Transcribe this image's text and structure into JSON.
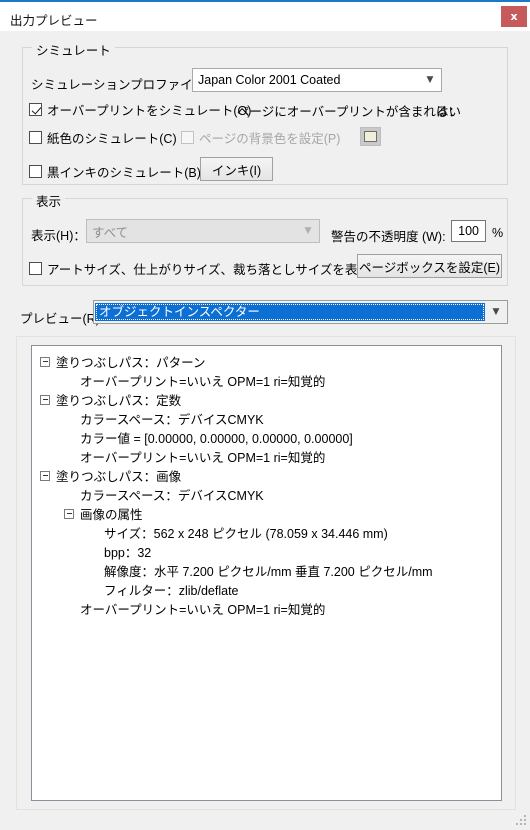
{
  "window": {
    "title": "出力プレビュー",
    "close_label": "x",
    "accent_color": "#1a7bc4",
    "close_color": "#c75b5b"
  },
  "simulate_group": {
    "title": "シミュレート",
    "profile_label": "シミュレーションプロファイル(S)：",
    "profile_value": "Japan Color 2001 Coated",
    "overprint_checkbox": "オーバープリントをシミュレート(O)",
    "overprint_checked": true,
    "overprint_info_label": "ページにオーバープリントが含まれる：",
    "overprint_info_value": "はい",
    "paper_color_checkbox": "紙色のシミュレート(C)",
    "paper_color_checked": false,
    "page_bg_checkbox": "ページの背景色を設定(P)",
    "page_bg_checked": false,
    "page_bg_disabled": true,
    "page_bg_swatch_color": "#f0f0da",
    "black_ink_checkbox": "黒インキのシミュレート(B)",
    "black_ink_checked": false,
    "ink_button": "インキ(I)"
  },
  "display_group": {
    "title": "表示",
    "show_label": "表示(H)：",
    "show_value": "すべて",
    "show_disabled": true,
    "warning_opacity_label": "警告の不透明度 (W):",
    "warning_opacity_value": "100",
    "percent_sign": "%",
    "sizes_checkbox": "アートサイズ、仕上がりサイズ、裁ち落としサイズを表示(X)",
    "sizes_checked": false,
    "page_box_button": "ページボックスを設定(E)"
  },
  "preview": {
    "label": "プレビュー(R)：",
    "value": "オブジェクトインスペクター",
    "highlight_color": "#0b6fd4"
  },
  "tree": [
    {
      "indent": 0,
      "toggle": true,
      "text": "塗りつぶしパス：パターン"
    },
    {
      "indent": 1,
      "toggle": false,
      "text": "オーバープリント=いいえ OPM=1 ri=知覚的"
    },
    {
      "indent": 0,
      "toggle": true,
      "text": "塗りつぶしパス：定数"
    },
    {
      "indent": 1,
      "toggle": false,
      "text": "カラースペース：デバイスCMYK"
    },
    {
      "indent": 1,
      "toggle": false,
      "text": "カラー値 = [0.00000, 0.00000, 0.00000, 0.00000]"
    },
    {
      "indent": 1,
      "toggle": false,
      "text": "オーバープリント=いいえ OPM=1 ri=知覚的"
    },
    {
      "indent": 0,
      "toggle": true,
      "text": "塗りつぶしパス：画像"
    },
    {
      "indent": 1,
      "toggle": false,
      "text": "カラースペース：デバイスCMYK"
    },
    {
      "indent": 1,
      "toggle": true,
      "text": "画像の属性"
    },
    {
      "indent": 2,
      "toggle": false,
      "text": "サイズ：562 x 248 ピクセル (78.059 x 34.446 mm)"
    },
    {
      "indent": 2,
      "toggle": false,
      "text": "bpp：32"
    },
    {
      "indent": 2,
      "toggle": false,
      "text": "解像度：水平 7.200 ピクセル/mm 垂直 7.200 ピクセル/mm"
    },
    {
      "indent": 2,
      "toggle": false,
      "text": "フィルター：zlib/deflate"
    },
    {
      "indent": 1,
      "toggle": false,
      "text": "オーバープリント=いいえ OPM=1 ri=知覚的"
    }
  ]
}
